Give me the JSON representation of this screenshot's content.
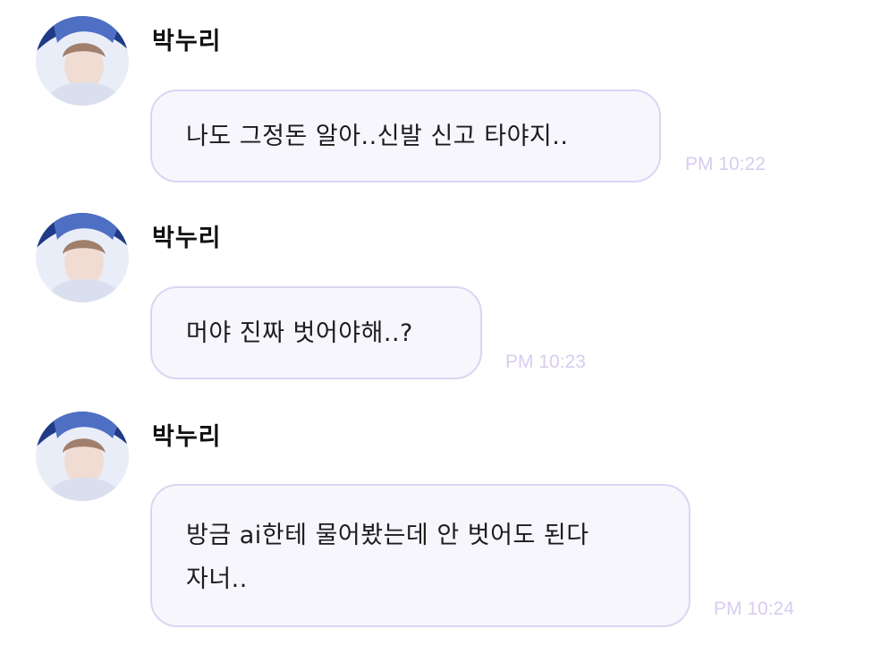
{
  "chat": {
    "messages": [
      {
        "sender": "박누리",
        "lines": [
          "나도 그정돈 알아..신발 신고 타야지.."
        ],
        "time": "PM 10:22",
        "avatar_icon": "profile-photo-icon"
      },
      {
        "sender": "박누리",
        "lines": [
          "머야 진짜 벗어야해..?"
        ],
        "time": "PM 10:23",
        "avatar_icon": "profile-photo-icon"
      },
      {
        "sender": "박누리",
        "lines": [
          "방금 ai한테 물어봤는데 안 벗어도 된다",
          "자너.."
        ],
        "time": "PM 10:24",
        "avatar_icon": "profile-photo-icon"
      }
    ]
  },
  "colors": {
    "bubble_background": "#f8f6fd",
    "bubble_border": "#ddd4f1",
    "timestamp": "#d8ccef",
    "sender": "#111111"
  }
}
